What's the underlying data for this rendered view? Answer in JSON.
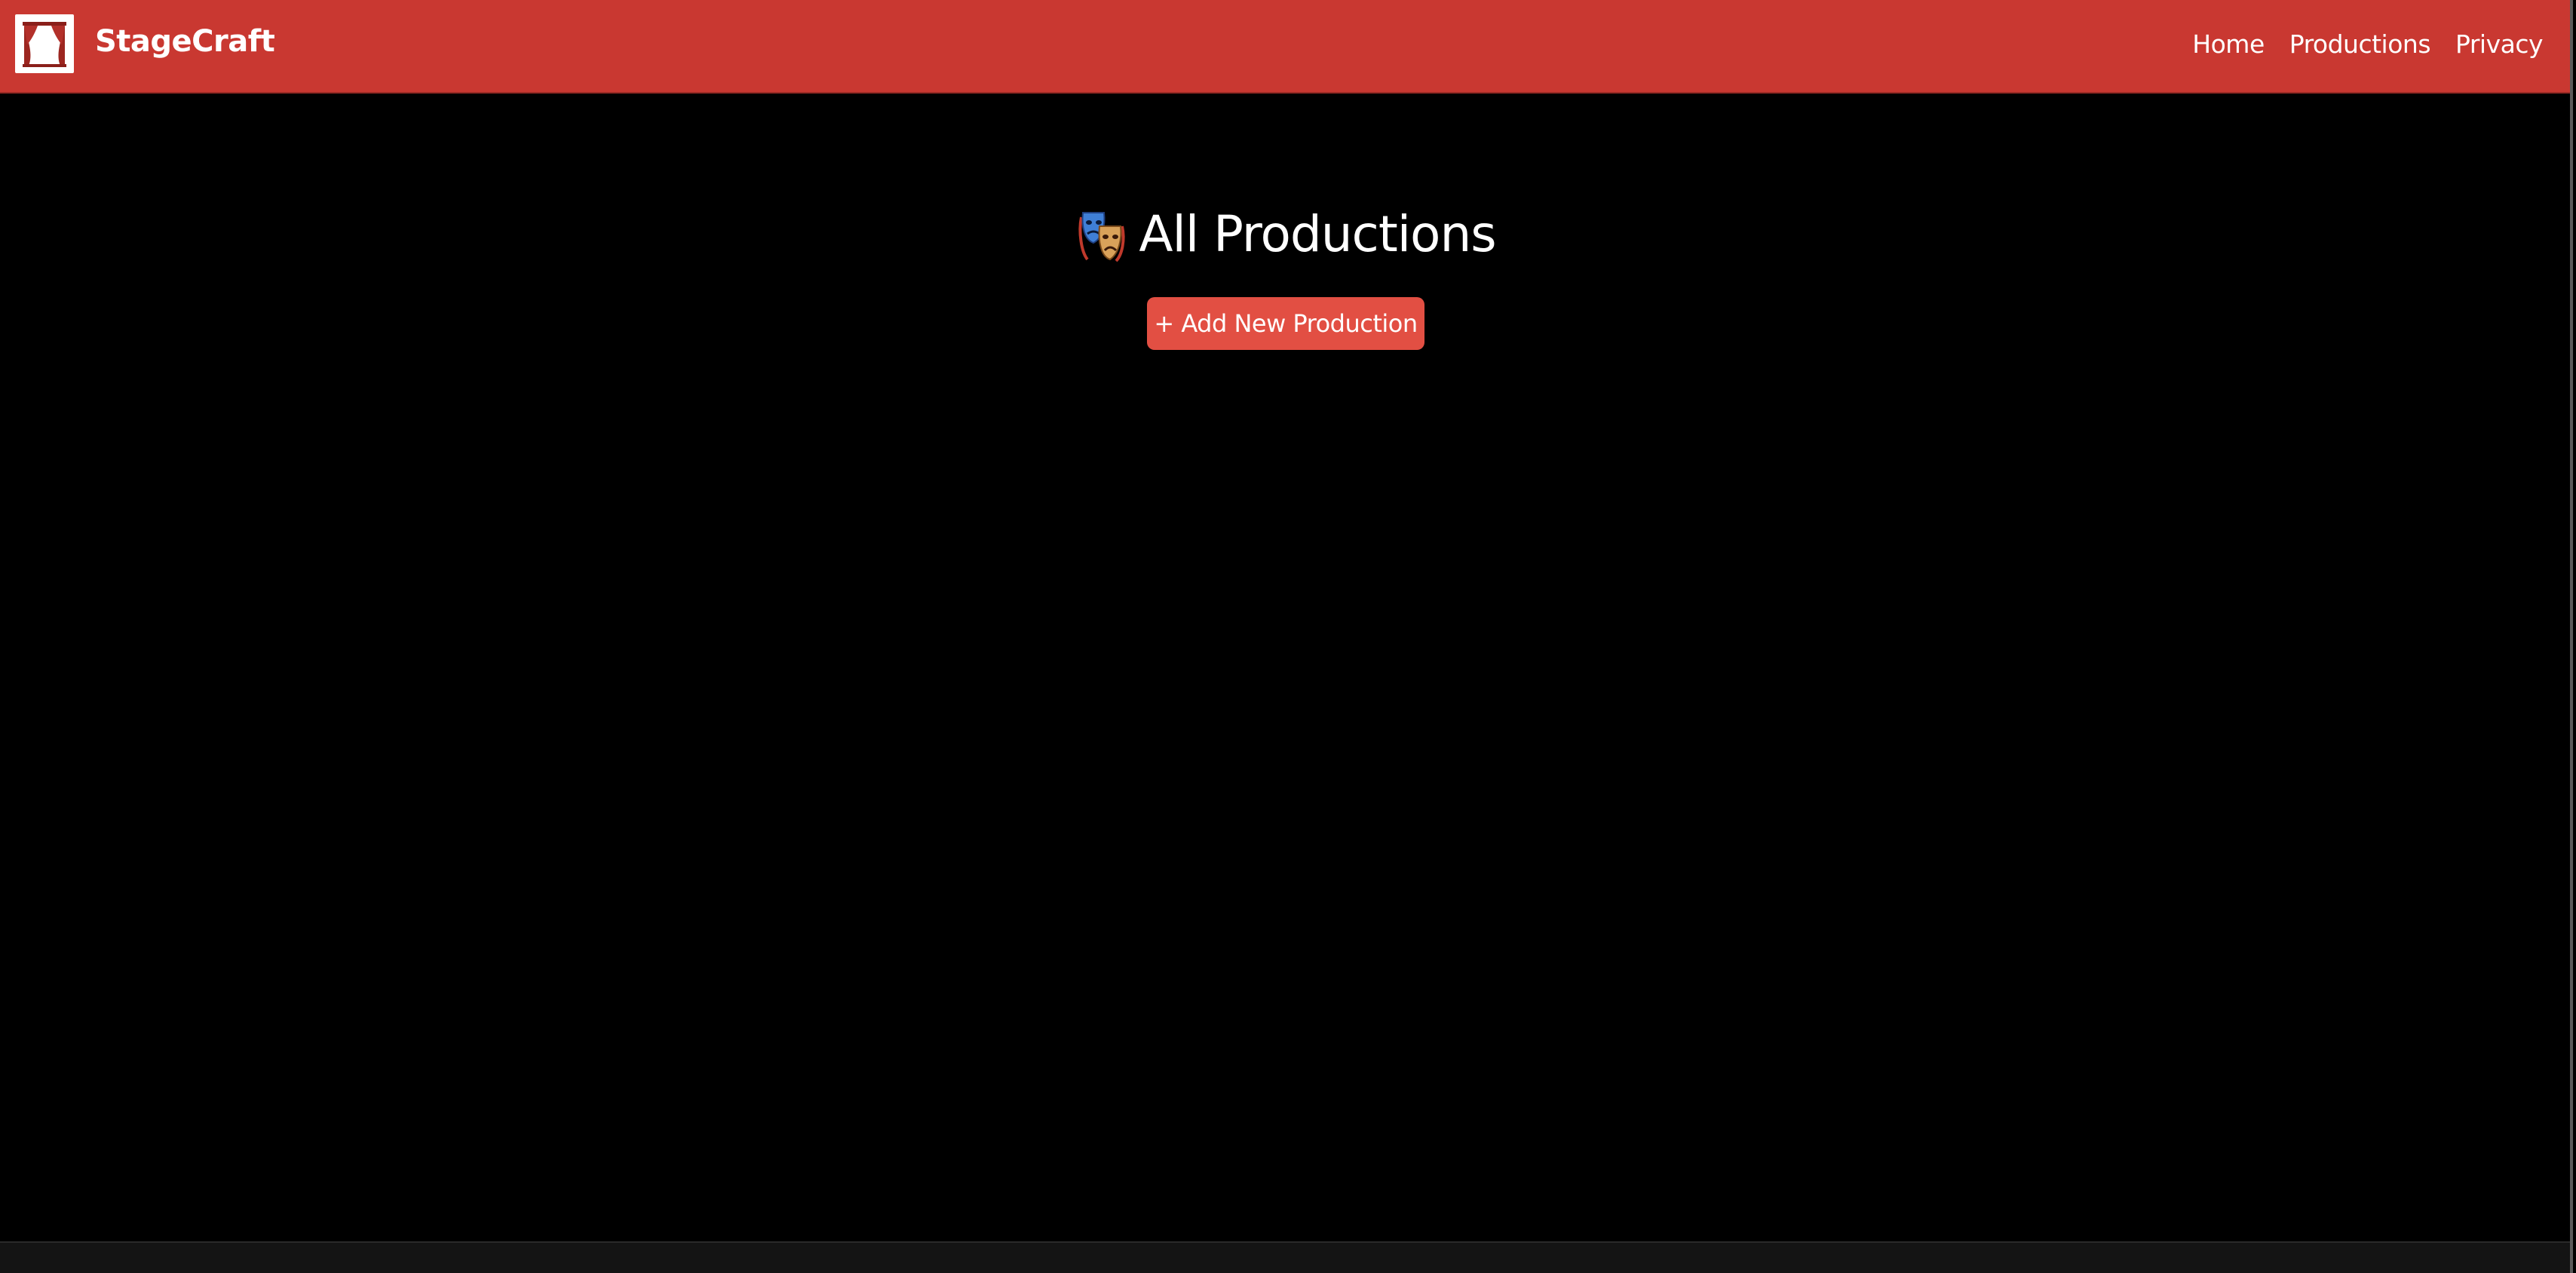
{
  "navbar": {
    "brand_name": "StageCraft",
    "logo_icon": "theater-curtain-icon",
    "links": [
      {
        "label": "Home"
      },
      {
        "label": "Productions"
      },
      {
        "label": "Privacy"
      }
    ]
  },
  "main": {
    "title_icon": "theater-masks-icon",
    "title": "All Productions",
    "add_button_label": "+ Add New Production"
  },
  "colors": {
    "navbar_bg": "#c93831",
    "button_bg": "#e24f43",
    "page_bg": "#000000",
    "footer_bg": "#141414"
  }
}
